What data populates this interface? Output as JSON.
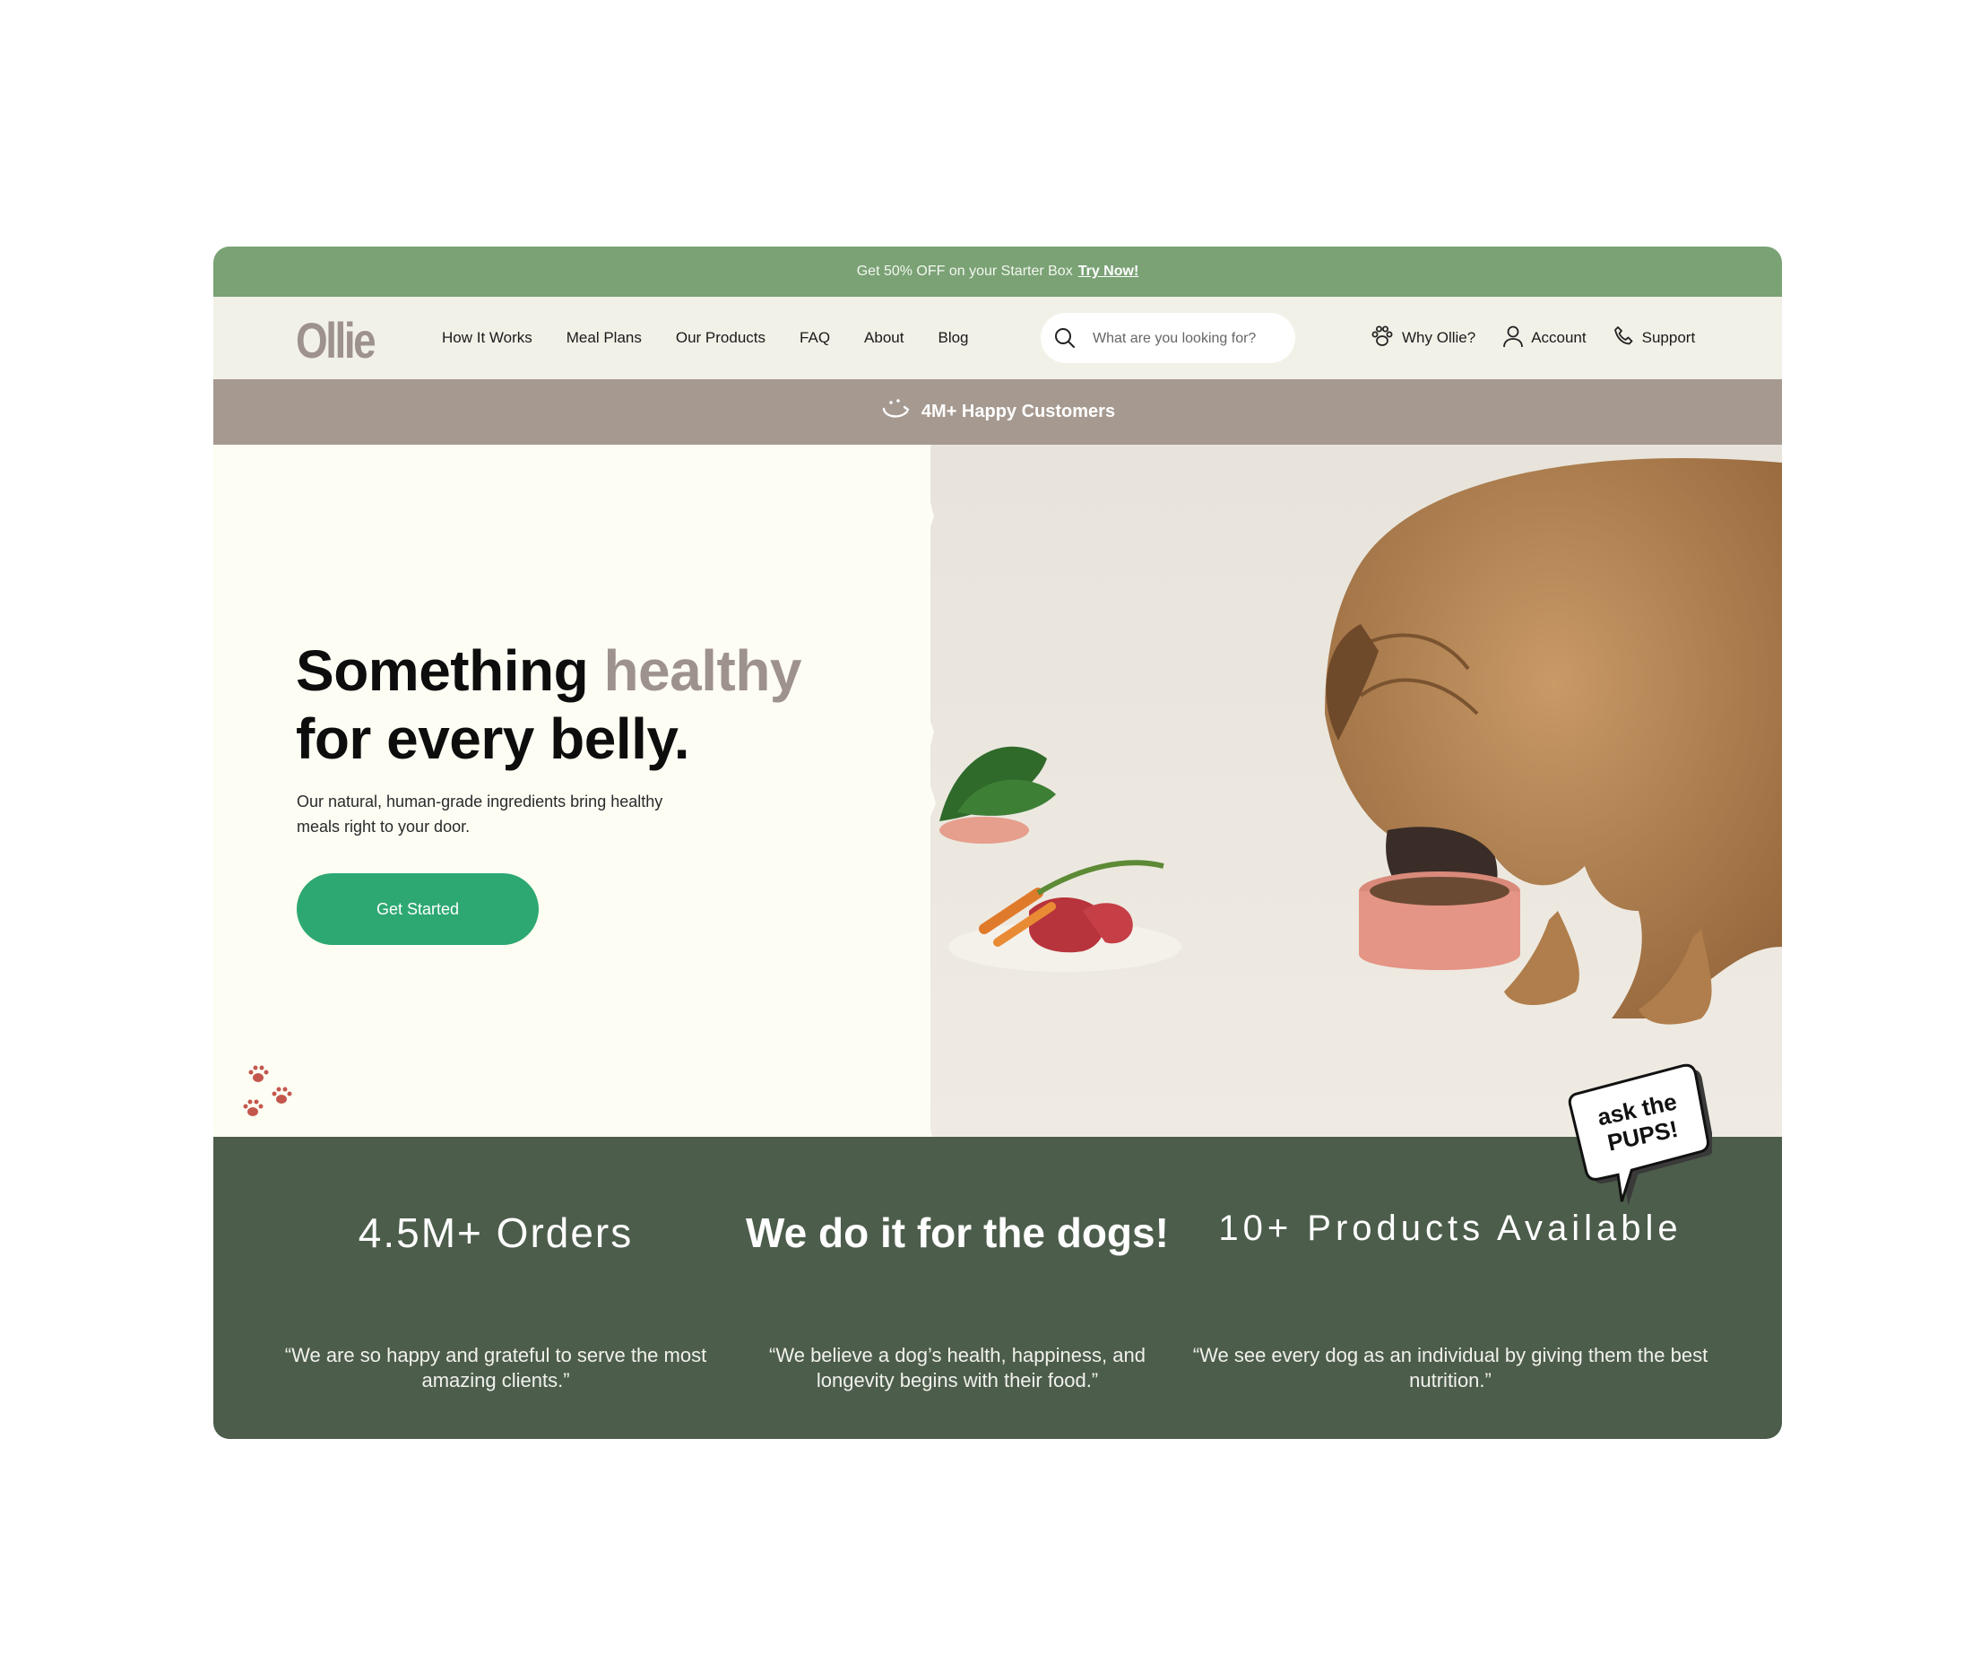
{
  "promo": {
    "text": "Get 50% OFF on your Starter Box",
    "link": "Try Now!"
  },
  "brand": {
    "logo": "Ollie",
    "accent_color": "#9e928c"
  },
  "nav": {
    "items": [
      "How It Works",
      "Meal Plans",
      "Our Products",
      "FAQ",
      "About",
      "Blog"
    ],
    "search_placeholder": "What are you looking for?",
    "utilities": [
      {
        "label": "Why Ollie?",
        "icon": "paw-icon"
      },
      {
        "label": "Account",
        "icon": "user-icon"
      },
      {
        "label": "Support",
        "icon": "phone-icon"
      }
    ]
  },
  "band": {
    "text": "4M+ Happy Customers",
    "icon": "smile-icon"
  },
  "hero": {
    "headline_part1": "Something ",
    "headline_accent": "healthy",
    "headline_line2": "for every belly.",
    "subtext": "Our natural, human-grade ingredients bring healthy meals right to your door.",
    "cta": "Get Started",
    "cta_color": "#2ea872"
  },
  "badge": {
    "line1": "ask the",
    "line2": "PUPS!"
  },
  "stats": [
    {
      "title": "4.5M+ Orders",
      "quote": "“We are so happy and grateful to serve the most amazing clients.”"
    },
    {
      "title": "We do it for the dogs!",
      "quote": "“We believe a dog’s health, happiness, and longevity begins with their food.”"
    },
    {
      "title": "10+ Products Available",
      "quote": "“We see every dog as an individual by giving them the best nutrition.”"
    }
  ],
  "colors": {
    "promo_bg": "#7aa275",
    "nav_bg": "#f2f1e8",
    "band_bg": "#a59990",
    "hero_bg": "#fdfdf4",
    "stats_bg": "#4c5d4b"
  }
}
